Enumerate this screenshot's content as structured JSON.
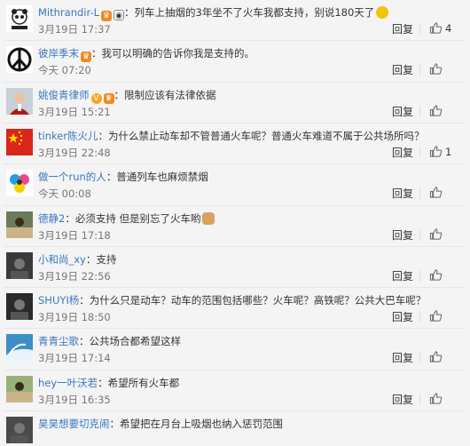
{
  "comments": [
    {
      "username": "Mithrandir-L",
      "badges": [
        "crown",
        "panda"
      ],
      "content": "：列车上抽烟的3年坐不了火车我都支持，别说180天了",
      "emoji": "smile",
      "time": "3月19日 17:37",
      "reply_label": "回复",
      "like_count": "4",
      "avatar": {
        "style": "panda",
        "bg": "#ffffff"
      }
    },
    {
      "username": "彼岸季末",
      "badges": [
        "crown"
      ],
      "content": "：我可以明确的告诉你我是支持的。",
      "emoji": "",
      "time": "今天 07:20",
      "reply_label": "回复",
      "like_count": "",
      "avatar": {
        "style": "peace",
        "bg": "#ffffff"
      }
    },
    {
      "username": "姚俊青律师",
      "badges": [
        "v",
        "crown"
      ],
      "content": "：限制应该有法律依据",
      "emoji": "",
      "time": "3月19日 15:21",
      "reply_label": "回复",
      "like_count": "",
      "avatar": {
        "style": "person",
        "bg": "#c8d0d8"
      }
    },
    {
      "username": "tinker陈火儿",
      "badges": [],
      "content": "：为什么禁止动车却不管普通火车呢？普通火车难道不属于公共场所吗？",
      "emoji": "",
      "time": "3月19日 22:48",
      "reply_label": "回复",
      "like_count": "1",
      "avatar": {
        "style": "flag",
        "bg": "#d9261c"
      }
    },
    {
      "username": "做一个run的人",
      "badges": [],
      "content": "：普通列车也麻烦禁烟",
      "emoji": "",
      "time": "今天 00:08",
      "reply_label": "回复",
      "like_count": "",
      "avatar": {
        "style": "rings",
        "bg": "#ffffff"
      }
    },
    {
      "username": "德静2",
      "badges": [],
      "content": "：必须支持 但是别忘了火车哟",
      "emoji": "dog",
      "time": "3月19日 17:18",
      "reply_label": "回复",
      "like_count": "",
      "avatar": {
        "style": "photo",
        "bg": "#6c7a5a"
      }
    },
    {
      "username": "小和尚_xy",
      "badges": [],
      "content": "：支持",
      "emoji": "",
      "time": "3月19日 22:56",
      "reply_label": "回复",
      "like_count": "",
      "avatar": {
        "style": "dark",
        "bg": "#3a3a3a"
      }
    },
    {
      "username": "SHUYI杨",
      "badges": [],
      "content": "：为什么只是动车？动车的范围包括哪些？火车呢？高铁呢？公共大巴车呢？",
      "emoji": "",
      "time": "3月19日 18:50",
      "reply_label": "回复",
      "like_count": "",
      "avatar": {
        "style": "dark",
        "bg": "#2a2a2a"
      }
    },
    {
      "username": "青青尘歌",
      "badges": [],
      "content": "：公共场合都希望这样",
      "emoji": "",
      "time": "3月19日 17:14",
      "reply_label": "回复",
      "like_count": "",
      "avatar": {
        "style": "sky",
        "bg": "#3b8fc4"
      }
    },
    {
      "username": "hey一叶沃若",
      "badges": [],
      "content": "：希望所有火车都",
      "emoji": "",
      "time": "3月19日 16:35",
      "reply_label": "回复",
      "like_count": "",
      "avatar": {
        "style": "photo",
        "bg": "#9ab07a"
      }
    },
    {
      "username": "昊昊想要切克闹",
      "badges": [],
      "content": "：希望把在月台上吸烟也纳入惩罚范围",
      "emoji": "",
      "time": "",
      "reply_label": "",
      "like_count": "",
      "avatar": {
        "style": "dark",
        "bg": "#4a4a4a"
      }
    }
  ]
}
